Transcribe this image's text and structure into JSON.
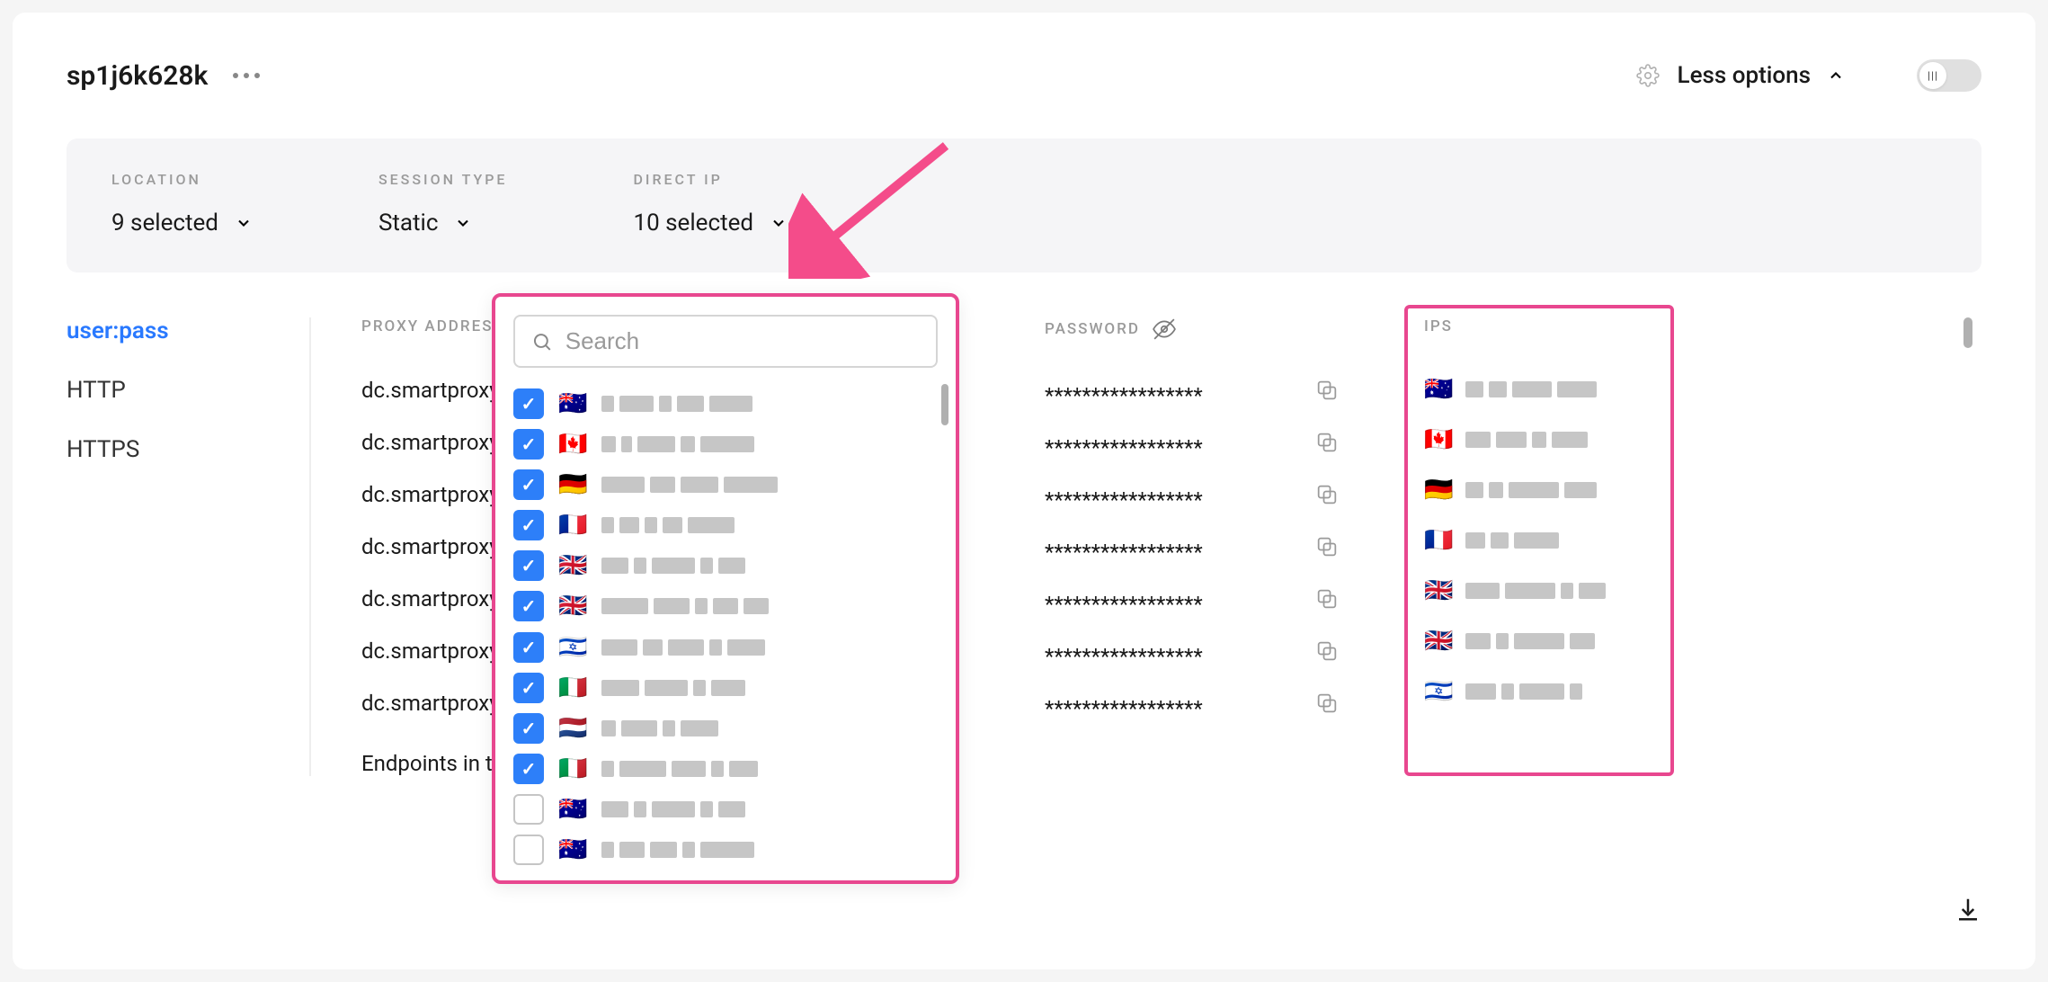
{
  "header": {
    "title": "sp1j6k628k",
    "options_label": "Less options"
  },
  "filters": {
    "location": {
      "label": "LOCATION",
      "value": "9 selected"
    },
    "session_type": {
      "label": "SESSION TYPE",
      "value": "Static"
    },
    "direct_ip": {
      "label": "DIRECT IP",
      "value": "10 selected"
    }
  },
  "dropdown": {
    "search_placeholder": "Search",
    "items": [
      {
        "flag": "🇦🇺",
        "checked": true
      },
      {
        "flag": "🇨🇦",
        "checked": true
      },
      {
        "flag": "🇩🇪",
        "checked": true
      },
      {
        "flag": "🇫🇷",
        "checked": true
      },
      {
        "flag": "🇬🇧",
        "checked": true
      },
      {
        "flag": "🇬🇧",
        "checked": true
      },
      {
        "flag": "🇮🇱",
        "checked": true
      },
      {
        "flag": "🇮🇹",
        "checked": true
      },
      {
        "flag": "🇳🇱",
        "checked": true
      },
      {
        "flag": "🇮🇹",
        "checked": true
      },
      {
        "flag": "🇦🇺",
        "checked": false
      },
      {
        "flag": "🇦🇺",
        "checked": false
      }
    ]
  },
  "tabs": {
    "userpass": "user:pass",
    "http": "HTTP",
    "https": "HTTPS"
  },
  "table": {
    "headers": {
      "proxy": "PROXY ADDRESS",
      "password": "PASSWORD",
      "ips": "IPS"
    },
    "proxy_rows": [
      "dc.smartproxy.co",
      "dc.smartproxy.co",
      "dc.smartproxy.co",
      "dc.smartproxy.co",
      "dc.smartproxy.co",
      "dc.smartproxy.co",
      "dc.smartproxy.co"
    ],
    "password_mask": "*****************",
    "ips_rows": [
      {
        "flag": "🇦🇺"
      },
      {
        "flag": "🇨🇦"
      },
      {
        "flag": "🇩🇪"
      },
      {
        "flag": "🇫🇷"
      },
      {
        "flag": "🇬🇧"
      },
      {
        "flag": "🇬🇧"
      },
      {
        "flag": "🇮🇱"
      }
    ],
    "endpoints_text": "Endpoints in this"
  }
}
